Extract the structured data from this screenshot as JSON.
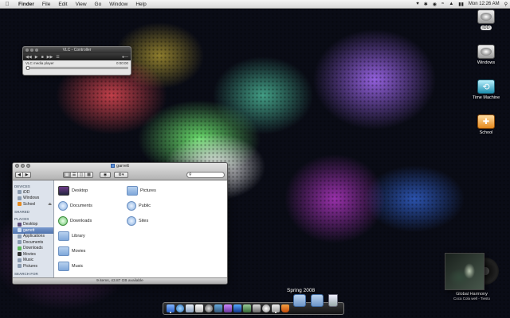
{
  "menubar": {
    "app_name": "Finder",
    "items": [
      "File",
      "Edit",
      "View",
      "Go",
      "Window",
      "Help"
    ],
    "clock": "Mon 12:26 AM"
  },
  "vlc": {
    "title": "VLC - Controller",
    "media_label": "VLC media player",
    "time": "0:00:00"
  },
  "finder": {
    "title": "garrett",
    "sidebar": {
      "devices_header": "DEVICES",
      "devices": [
        "iDD",
        "Windows",
        "School"
      ],
      "shared_header": "SHARED",
      "places_header": "PLACES",
      "places": [
        "Desktop",
        "garrett",
        "Applications",
        "Documents",
        "Downloads",
        "Movies",
        "Music",
        "Pictures"
      ],
      "search_header": "SEARCH FOR"
    },
    "items": [
      {
        "name": "Desktop",
        "icon": "desktop-folder-icon"
      },
      {
        "name": "Documents",
        "icon": "documents-folder-icon"
      },
      {
        "name": "Downloads",
        "icon": "downloads-folder-icon"
      },
      {
        "name": "Library",
        "icon": "library-folder-icon"
      },
      {
        "name": "Movies",
        "icon": "movies-folder-icon"
      },
      {
        "name": "Music",
        "icon": "music-folder-icon"
      },
      {
        "name": "Pictures",
        "icon": "pictures-folder-icon"
      },
      {
        "name": "Public",
        "icon": "public-folder-icon"
      },
      {
        "name": "Sites",
        "icon": "sites-folder-icon"
      }
    ],
    "status": "9 items, 43.87 GB available"
  },
  "desktop_icons": [
    {
      "label": "iDD",
      "icon": "hard-drive-icon",
      "selected": true
    },
    {
      "label": "Windows",
      "icon": "hard-drive-icon",
      "selected": false
    },
    {
      "label": "Time Machine",
      "icon": "time-machine-icon",
      "selected": false
    },
    {
      "label": "School",
      "icon": "usb-drive-icon",
      "selected": false
    }
  ],
  "now_playing": {
    "track": "Global Harmony",
    "artist_album": "Coca Cola well - Tiesto"
  },
  "dock": {
    "stack_label": "Spring 2008"
  }
}
